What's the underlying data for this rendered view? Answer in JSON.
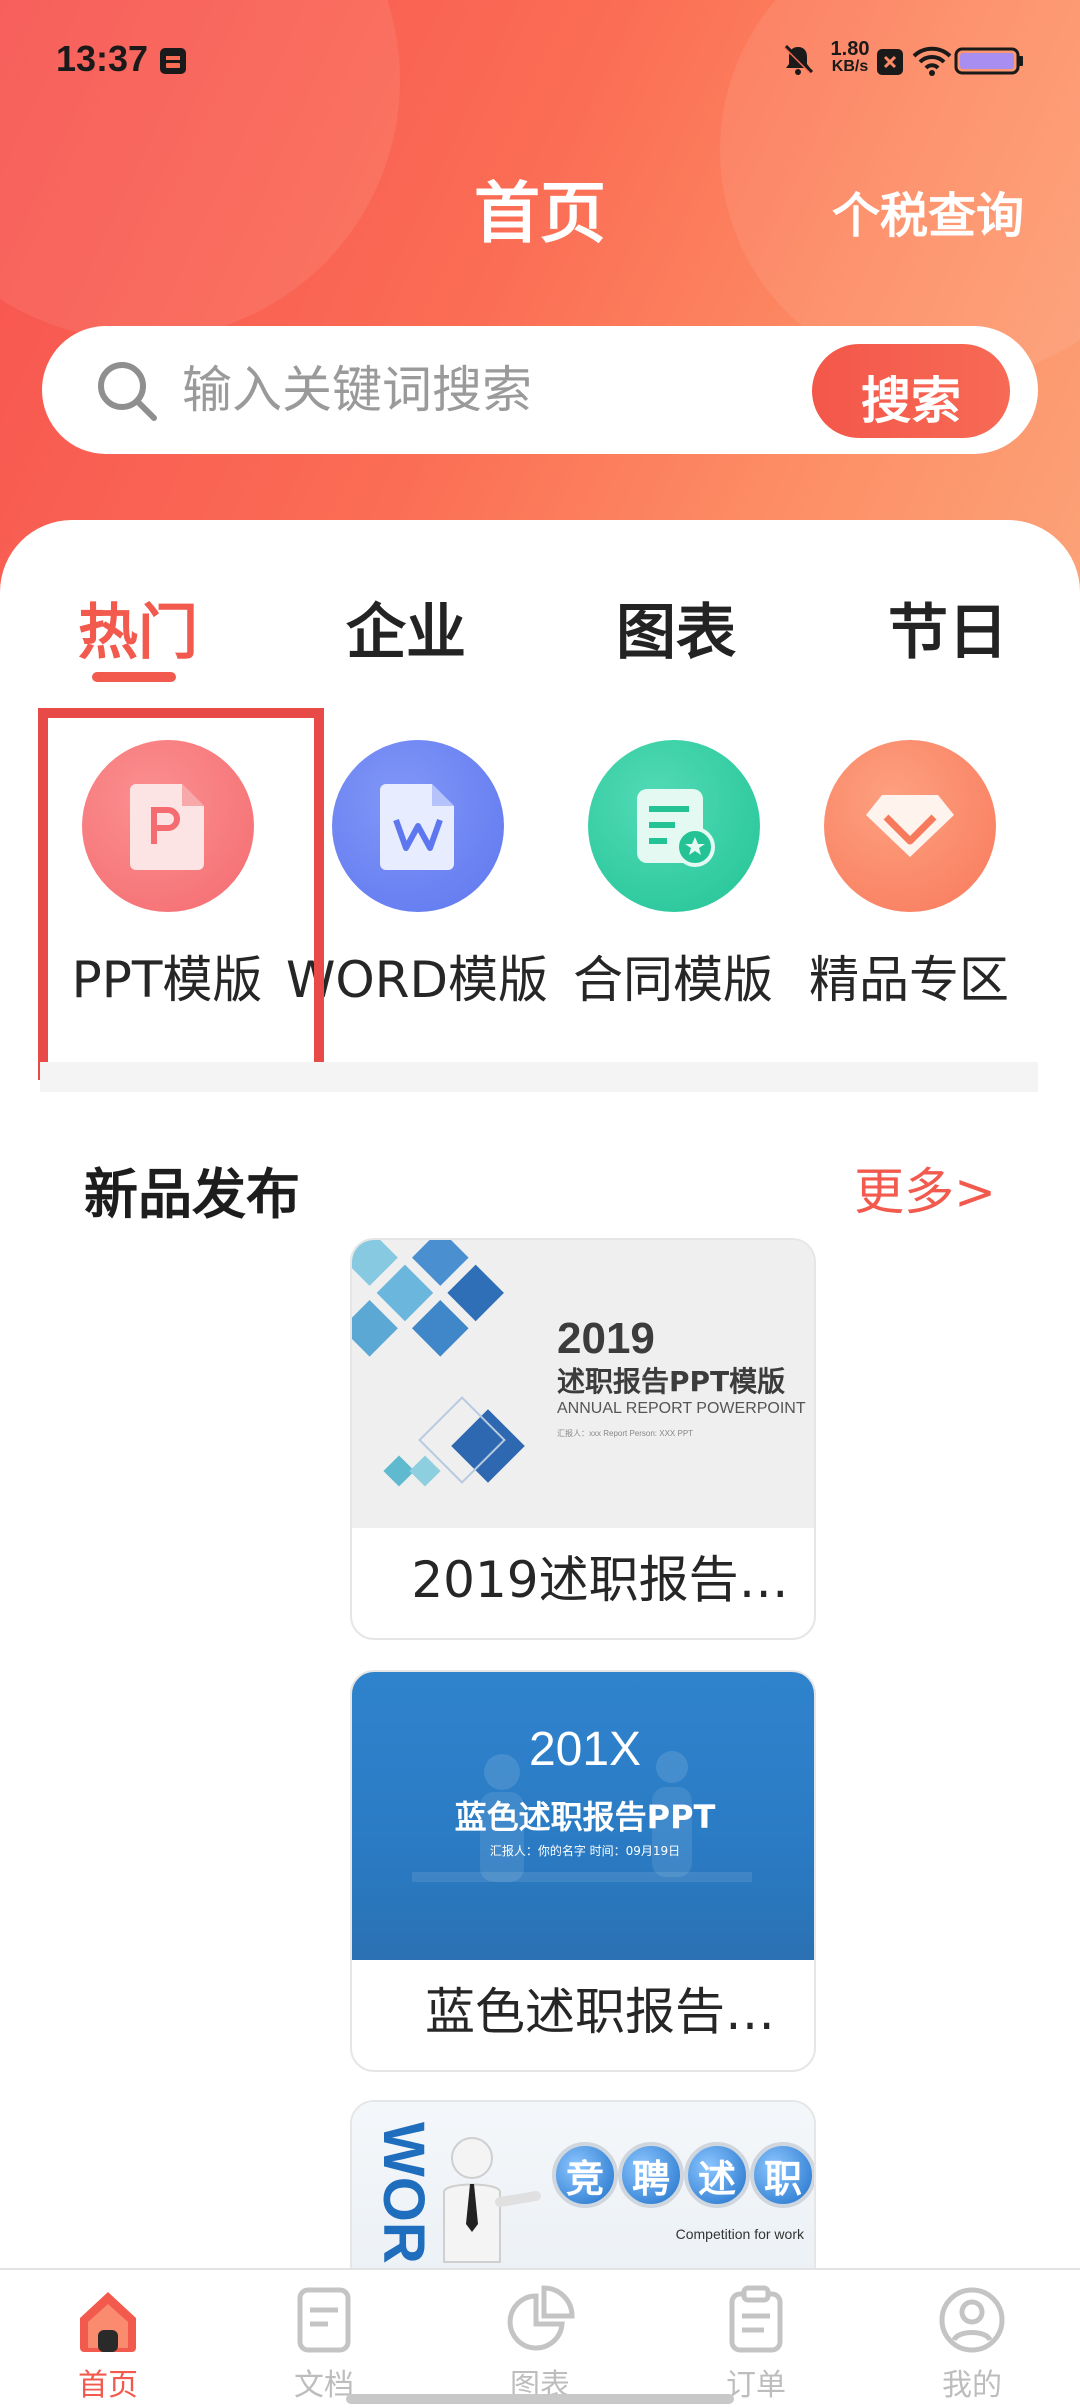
{
  "status_bar": {
    "time": "13:37",
    "net_speed_value": "1.80",
    "net_speed_unit": "KB/s",
    "icons": [
      "notification-box-icon",
      "mute-bell-icon",
      "close-box-icon",
      "wifi-icon",
      "battery-icon"
    ]
  },
  "header": {
    "title": "首页",
    "tax_link": "个税查询"
  },
  "search": {
    "placeholder": "输入关键词搜索",
    "button_label": "搜索"
  },
  "tabs": [
    {
      "label": "热门",
      "active": true
    },
    {
      "label": "企业",
      "active": false
    },
    {
      "label": "图表",
      "active": false
    },
    {
      "label": "节日",
      "active": false
    }
  ],
  "categories": [
    {
      "label": "PPT模版",
      "icon": "ppt-icon",
      "color": "#f7777a"
    },
    {
      "label": "WORD模版",
      "icon": "word-icon",
      "color": "#6f86f5"
    },
    {
      "label": "合同模版",
      "icon": "contract-icon",
      "color": "#34cfa5"
    },
    {
      "label": "精品专区",
      "icon": "diamond-icon",
      "color": "#fb8a6a"
    }
  ],
  "section": {
    "title": "新品发布",
    "more_label": "更多>"
  },
  "cards": [
    {
      "caption": "2019述职报告…",
      "thumb_year": "2019",
      "thumb_title": "述职报告PPT模版",
      "thumb_subtitle": "ANNUAL REPORT POWERPOINT",
      "thumb_meta": "汇报人：xxx      Report Person: XXX PPT"
    },
    {
      "caption": "蓝色述职报告…",
      "thumb_year": "201X",
      "thumb_title": "蓝色述职报告PPT",
      "thumb_subtitle": "汇报人：你的名字   时间：09月19日"
    },
    {
      "caption": "",
      "thumb_word": "WOR",
      "thumb_chars": [
        "竞",
        "聘",
        "述",
        "职"
      ],
      "thumb_caption": "Competition for work"
    }
  ],
  "bottom_nav": [
    {
      "label": "首页",
      "icon": "home-icon",
      "active": true
    },
    {
      "label": "文档",
      "icon": "document-icon",
      "active": false
    },
    {
      "label": "图表",
      "icon": "pie-chart-icon",
      "active": false
    },
    {
      "label": "订单",
      "icon": "clipboard-icon",
      "active": false
    },
    {
      "label": "我的",
      "icon": "user-icon",
      "active": false
    }
  ],
  "colors": {
    "accent": "#f25a4e",
    "gradient_start": "#f7524f",
    "gradient_end": "#fca37a",
    "inactive": "#bdbdbd"
  }
}
